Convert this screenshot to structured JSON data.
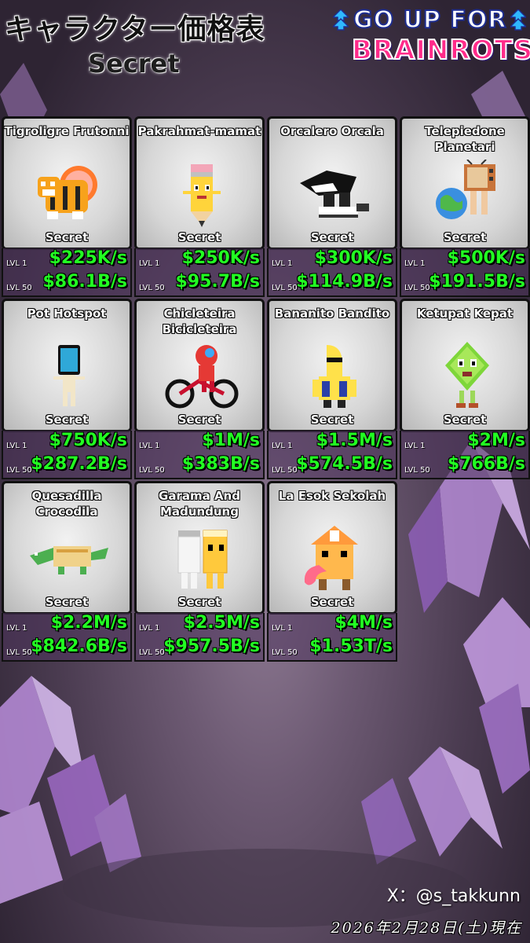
{
  "header": {
    "title": "キャラクター価格表",
    "subtitle": "Secret"
  },
  "logo": {
    "line1": "GO UP FOR",
    "line2": "BRAINROTS"
  },
  "cards": [
    {
      "name": "Tigroligre Frutonni",
      "rarity": "Secret",
      "lvl1_label": "LVL 1",
      "lvl1_value": "$225K/s",
      "lvl50_label": "LVL 50",
      "lvl50_value": "$86.1B/s",
      "icon": "tiger-fruit-icon"
    },
    {
      "name": "Pakrahmat-mamat",
      "rarity": "Secret",
      "lvl1_label": "LVL 1",
      "lvl1_value": "$250K/s",
      "lvl50_label": "LVL 50",
      "lvl50_value": "$95.7B/s",
      "icon": "pencil-character-icon"
    },
    {
      "name": "Orcalero Orcala",
      "rarity": "Secret",
      "lvl1_label": "LVL 1",
      "lvl1_value": "$300K/s",
      "lvl50_label": "LVL 50",
      "lvl50_value": "$114.9B/s",
      "icon": "orca-sneakers-icon"
    },
    {
      "name": "Telepiedone Planetari",
      "rarity": "Secret",
      "lvl1_label": "LVL 1",
      "lvl1_value": "$500K/s",
      "lvl50_label": "LVL 50",
      "lvl50_value": "$191.5B/s",
      "icon": "tv-planet-icon"
    },
    {
      "name": "Pot Hotspot",
      "rarity": "Secret",
      "lvl1_label": "LVL 1",
      "lvl1_value": "$750K/s",
      "lvl50_label": "LVL 50",
      "lvl50_value": "$287.2B/s",
      "icon": "phone-skeleton-icon"
    },
    {
      "name": "Chicleteira Bicicleteira",
      "rarity": "Secret",
      "lvl1_label": "LVL 1",
      "lvl1_value": "$1M/s",
      "lvl50_label": "LVL 50",
      "lvl50_value": "$383B/s",
      "icon": "gumball-bike-icon"
    },
    {
      "name": "Bananito Bandito",
      "rarity": "Secret",
      "lvl1_label": "LVL 1",
      "lvl1_value": "$1.5M/s",
      "lvl50_label": "LVL 50",
      "lvl50_value": "$574.5B/s",
      "icon": "banana-bandit-icon"
    },
    {
      "name": "Ketupat Kepat",
      "rarity": "Secret",
      "lvl1_label": "LVL 1",
      "lvl1_value": "$2M/s",
      "lvl50_label": "LVL 50",
      "lvl50_value": "$766B/s",
      "icon": "ketupat-creature-icon"
    },
    {
      "name": "Quesadilla Crocodila",
      "rarity": "Secret",
      "lvl1_label": "LVL 1",
      "lvl1_value": "$2.2M/s",
      "lvl50_label": "LVL 50",
      "lvl50_value": "$842.6B/s",
      "icon": "quesadilla-croc-icon"
    },
    {
      "name": "Garama And Madundung",
      "rarity": "Secret",
      "lvl1_label": "LVL 1",
      "lvl1_value": "$2.5M/s",
      "lvl50_label": "LVL 50",
      "lvl50_value": "$957.5B/s",
      "icon": "salt-and-drink-icon"
    },
    {
      "name": "La Esok Sekolah",
      "rarity": "Secret",
      "lvl1_label": "LVL 1",
      "lvl1_value": "$4M/s",
      "lvl50_label": "LVL 50",
      "lvl50_value": "$1.53T/s",
      "icon": "school-house-icon"
    }
  ],
  "footer": {
    "account": "X：@s_takkunn",
    "date": "2026年2月28日(土)現在"
  },
  "colors": {
    "value_green": "#22ff22",
    "card_border": "#111111",
    "background": "#5e4d66",
    "logo_pink": "#ff2b8a",
    "logo_blue": "#1e2d8f"
  }
}
